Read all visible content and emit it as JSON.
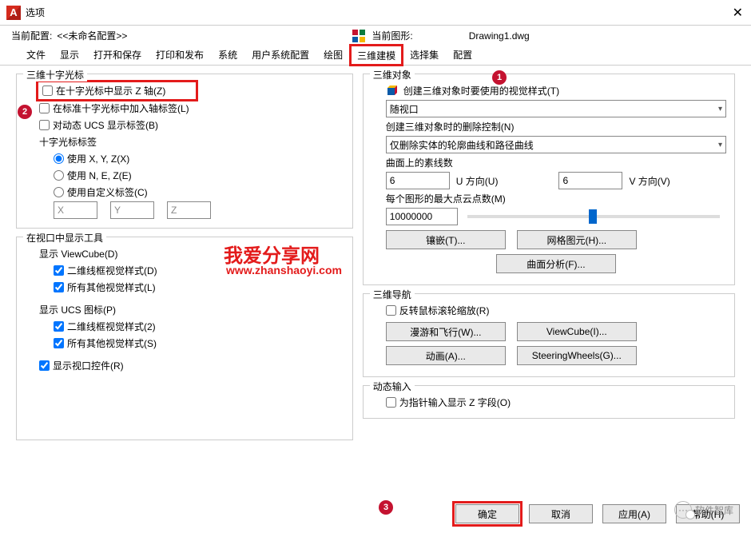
{
  "window": {
    "title": "选项"
  },
  "profile": {
    "label": "当前配置:",
    "value": "<<未命名配置>>",
    "drawing_label": "当前图形:",
    "drawing_value": "Drawing1.dwg"
  },
  "tabs": [
    "文件",
    "显示",
    "打开和保存",
    "打印和发布",
    "系统",
    "用户系统配置",
    "绘图",
    "三维建模",
    "选择集",
    "配置"
  ],
  "active_tab": "三维建模",
  "badges": {
    "b1": "1",
    "b2": "2",
    "b3": "3"
  },
  "left": {
    "group1_title": "三维十字光标",
    "chk_showz": "在十字光标中显示 Z 轴(Z)",
    "chk_axislabel": "在标准十字光标中加入轴标签(L)",
    "chk_dynucs": "对动态 UCS 显示标签(B)",
    "lbl_crosshair": "十字光标标签",
    "rad_xyz": "使用 X, Y, Z(X)",
    "rad_nez": "使用 N, E, Z(E)",
    "rad_custom": "使用自定义标签(C)",
    "ph_x": "X",
    "ph_y": "Y",
    "ph_z": "Z",
    "group2_title": "在视口中显示工具",
    "lbl_vc": "显示 ViewCube(D)",
    "chk_vc_2d": "二维线框视觉样式(D)",
    "chk_vc_other": "所有其他视觉样式(L)",
    "lbl_ucs": "显示 UCS 图标(P)",
    "chk_ucs_2d": "二维线框视觉样式(2)",
    "chk_ucs_other": "所有其他视觉样式(S)",
    "chk_vp": "显示视口控件(R)"
  },
  "right": {
    "group1_title": "三维对象",
    "lbl_visual": "创建三维对象时要使用的视觉样式(T)",
    "combo_visual": "随视口",
    "lbl_delete": "创建三维对象时的删除控制(N)",
    "combo_delete": "仅删除实体的轮廓曲线和路径曲线",
    "lbl_isolines": "曲面上的素线数",
    "iso_u_val": "6",
    "iso_u_lbl": "U 方向(U)",
    "iso_v_val": "6",
    "iso_v_lbl": "V 方向(V)",
    "lbl_maxpts": "每个图形的最大点云点数(M)",
    "maxpts_val": "10000000",
    "btn_tess": "镶嵌(T)...",
    "btn_mesh": "网格图元(H)...",
    "btn_surf": "曲面分析(F)...",
    "group2_title": "三维导航",
    "chk_revwheel": "反转鼠标滚轮缩放(R)",
    "btn_walk": "漫游和飞行(W)...",
    "btn_vc": "ViewCube(I)...",
    "btn_anim": "动画(A)...",
    "btn_sw": "SteeringWheels(G)...",
    "group3_title": "动态输入",
    "chk_zfield": "为指针输入显示 Z 字段(O)"
  },
  "buttons": {
    "ok": "确定",
    "cancel": "取消",
    "apply": "应用(A)",
    "help": "帮助(H)"
  },
  "watermark": {
    "text1": "我爱分享网",
    "text2": "www.zhanshaoyi.com",
    "text3": "软件智库"
  }
}
